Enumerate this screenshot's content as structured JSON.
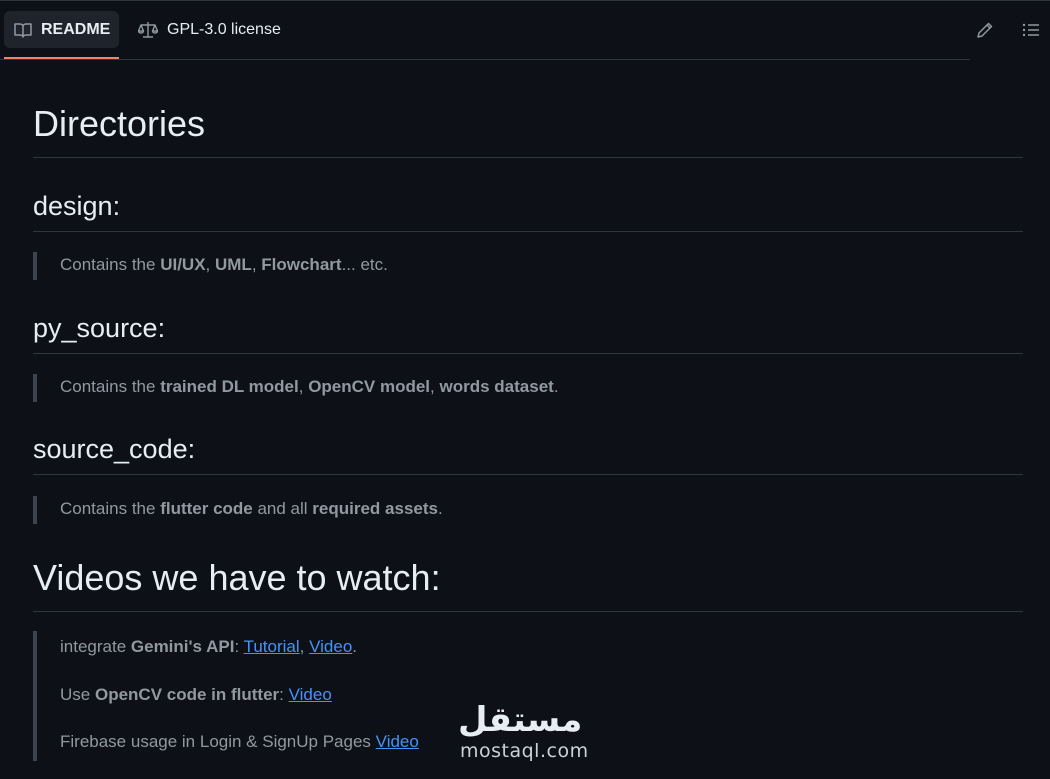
{
  "tabs": {
    "readme": "README",
    "license": "GPL-3.0 license"
  },
  "icons": {
    "readme": "book-icon",
    "license": "law-scale-icon",
    "edit": "pencil-icon",
    "outline": "list-unordered-icon"
  },
  "sections": {
    "directories": "Directories",
    "design": {
      "heading": "design:",
      "pre": "Contains the ",
      "b1": "UI/UX",
      "c1": ", ",
      "b2": "UML",
      "c2": ", ",
      "b3": "Flowchart",
      "post": "... etc."
    },
    "py_source": {
      "heading": "py_source:",
      "pre": "Contains the ",
      "b1": "trained DL model",
      "c1": ", ",
      "b2": "OpenCV model",
      "c2": ", ",
      "b3": "words dataset",
      "post": "."
    },
    "source_code": {
      "heading": "source_code:",
      "pre": "Contains the ",
      "b1": "flutter code",
      "mid": " and all ",
      "b2": "required assets",
      "post": "."
    },
    "videos": {
      "heading": "Videos we have to watch:",
      "item1": {
        "pre": "integrate ",
        "bold": "Gemini's API",
        "colon": ": ",
        "link1": "Tutorial",
        "sep": ", ",
        "link2": "Video",
        "post": "."
      },
      "item2": {
        "pre": "Use ",
        "bold": "OpenCV code in flutter",
        "colon": ": ",
        "link": "Video"
      },
      "item3": {
        "pre": "Firebase usage in Login & SignUp Pages ",
        "link": "Video"
      }
    }
  },
  "watermark": {
    "logo": "مستقل",
    "text": "mostaql.com"
  }
}
